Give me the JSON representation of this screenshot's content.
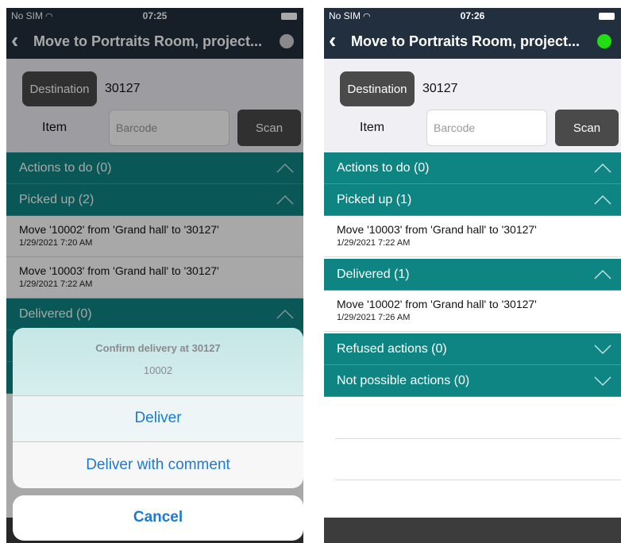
{
  "left": {
    "status": {
      "carrier": "No SIM",
      "time": "07:25"
    },
    "nav": {
      "back": "‹",
      "title": "Move to Portraits Room, project...",
      "indicator_color": "#d0d0d0"
    },
    "form": {
      "destination_label": "Destination",
      "destination_value": "30127",
      "item_label": "Item",
      "barcode_placeholder": "Barcode",
      "scan_label": "Scan"
    },
    "sections": [
      {
        "label": "Actions to do (0)",
        "state": "expanded"
      },
      {
        "label": "Picked up (2)",
        "state": "expanded"
      },
      {
        "label": "Delivered (0)",
        "state": "expanded"
      }
    ],
    "picked_up": [
      {
        "desc": "Move '10002' from 'Grand hall' to '30127'",
        "date": "1/29/2021 7:20 AM"
      },
      {
        "desc": "Move '10003' from 'Grand hall' to '30127'",
        "date": "1/29/2021 7:22 AM"
      }
    ],
    "sheet": {
      "title": "Confirm delivery at 30127",
      "subtitle": "10002",
      "options": [
        "Deliver",
        "Deliver with comment"
      ],
      "cancel": "Cancel"
    }
  },
  "right": {
    "status": {
      "carrier": "No SIM",
      "time": "07:26"
    },
    "nav": {
      "back": "‹",
      "title": "Move to Portraits Room, project...",
      "indicator_color": "#22dd11"
    },
    "form": {
      "destination_label": "Destination",
      "destination_value": "30127",
      "item_label": "Item",
      "barcode_placeholder": "Barcode",
      "scan_label": "Scan"
    },
    "sections": [
      {
        "label": "Actions to do (0)",
        "state": "expanded"
      },
      {
        "label": "Picked up (1)",
        "state": "expanded"
      },
      {
        "label": "Delivered (1)",
        "state": "expanded"
      },
      {
        "label": "Refused actions (0)",
        "state": "collapsed"
      },
      {
        "label": "Not possible actions (0)",
        "state": "collapsed"
      }
    ],
    "picked_up": [
      {
        "desc": "Move '10003' from 'Grand hall' to '30127'",
        "date": "1/29/2021 7:22 AM"
      }
    ],
    "delivered": [
      {
        "desc": "Move '10002' from 'Grand hall' to '30127'",
        "date": "1/29/2021 7:26 AM"
      }
    ]
  },
  "colors": {
    "navbar": "#222f3e",
    "section": "#0f8583",
    "accent_blue": "#1a7ad8",
    "button_dark": "#4a4a4a"
  },
  "icons": {
    "back": "chevron-left-icon",
    "expanded": "chevron-up-icon",
    "collapsed": "chevron-down-icon",
    "wifi": "wifi-icon",
    "battery": "battery-icon"
  }
}
